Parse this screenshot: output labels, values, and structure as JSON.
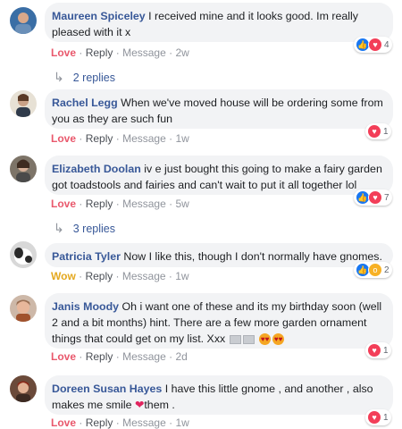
{
  "labels": {
    "reply": "Reply",
    "message": "Message",
    "sep": "·"
  },
  "comments": [
    {
      "author": "Maureen Spiceley",
      "text": "I received mine and it looks good. Im really pleased with it x",
      "reaction_label": "Love",
      "time": "2w",
      "reaction_count": "4",
      "reactions": [
        "like",
        "love"
      ],
      "replies": "2 replies"
    },
    {
      "author": "Rachel Legg",
      "text": "When we've moved house will be ordering some from you as they are such fun",
      "reaction_label": "Love",
      "time": "1w",
      "reaction_count": "1",
      "reactions": [
        "love"
      ]
    },
    {
      "author": "Elizabeth Doolan",
      "text": "iv e just bought this going to make a fairy garden got toadstools and fairies and can't wait to put it all together lol",
      "reaction_label": "Love",
      "time": "5w",
      "reaction_count": "7",
      "reactions": [
        "like",
        "love"
      ],
      "replies": "3 replies"
    },
    {
      "author": "Patricia Tyler",
      "text": "Now I like this, though I don't normally have gnomes.",
      "reaction_label": "Wow",
      "time": "1w",
      "reaction_count": "2",
      "reactions": [
        "like",
        "wow"
      ]
    },
    {
      "author": "Janis Moody",
      "text": "Oh i want one of these and its my birthday soon (well 2 and a bit months) hint. There are a few more garden ornament things that could get on my list. Xxx",
      "reaction_label": "Love",
      "time": "2d",
      "reaction_count": "1",
      "reactions": [
        "love"
      ]
    },
    {
      "author": "Doreen Susan Hayes",
      "text_before": "I have this little gnome , and another , also makes me smile",
      "text_after": "them .",
      "reaction_label": "Love",
      "time": "1w",
      "reaction_count": "1",
      "reactions": [
        "love"
      ]
    }
  ],
  "icons": {
    "like": "thumbs-up-icon",
    "love": "heart-icon",
    "wow": "wow-face-icon",
    "reply_arrow": "reply-arrow-icon"
  },
  "colors": {
    "author": "#385898",
    "love": "#e9586c",
    "wow": "#e4a81f",
    "bubble": "#f2f3f5"
  }
}
